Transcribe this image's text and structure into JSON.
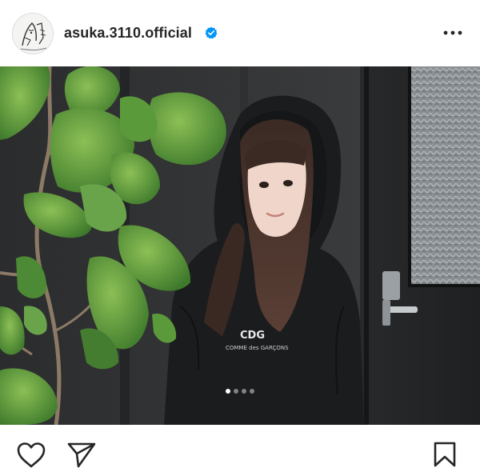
{
  "post": {
    "username": "asuka.3110.official",
    "verified": true,
    "carousel": {
      "total": 4,
      "active_index": 0
    }
  },
  "icons": {
    "more": "more-horizontal-icon",
    "like": "heart-icon",
    "share": "paper-plane-icon",
    "save": "bookmark-icon",
    "verified": "verified-badge-icon"
  },
  "colors": {
    "text": "#262626",
    "verified": "#0095f6",
    "border": "#dbdbdb"
  }
}
